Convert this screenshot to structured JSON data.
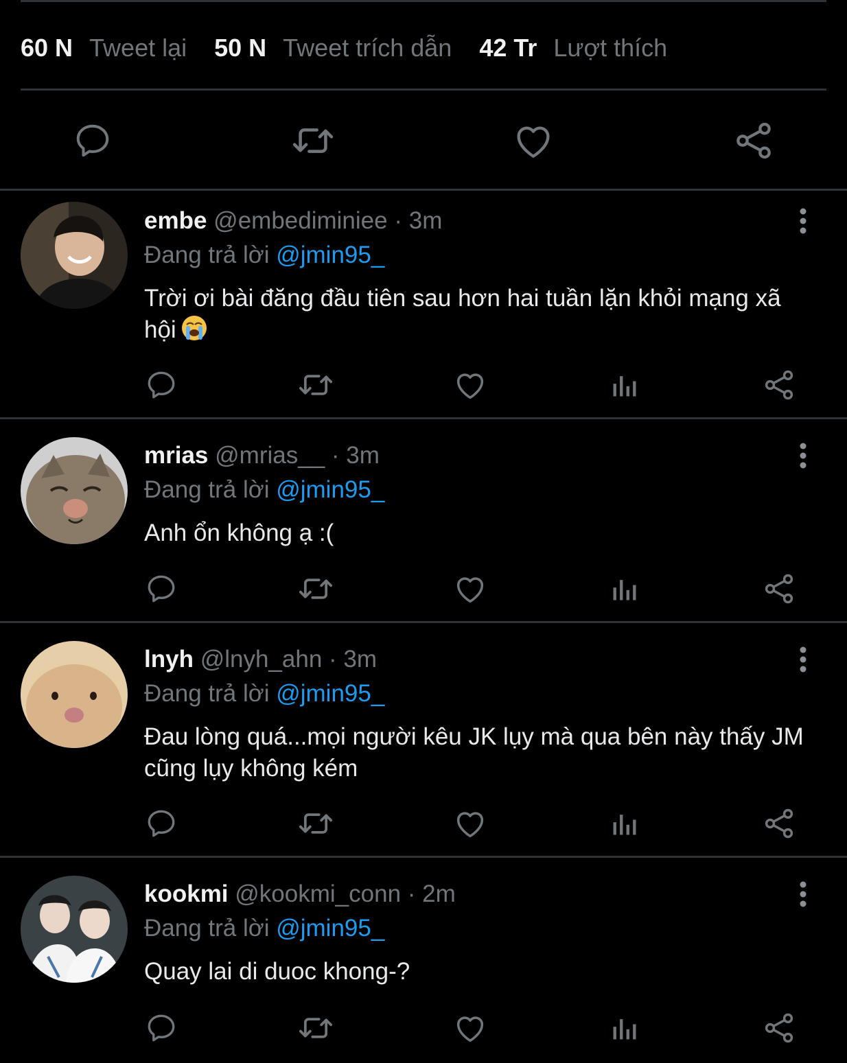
{
  "stats": [
    {
      "value": "60 N",
      "label": "Tweet lại"
    },
    {
      "value": "50 N",
      "label": "Tweet trích dẫn"
    },
    {
      "value": "42 Tr",
      "label": "Lượt thích"
    }
  ],
  "main_actions": [
    "comment-icon",
    "retweet-icon",
    "heart-icon",
    "share-icon"
  ],
  "replies": [
    {
      "display_name": "embe",
      "handle": "@embediminiee",
      "time": "3m",
      "replying_label": "Đang trả lời",
      "mention": "@jmin95_",
      "text": "Trời ơi bài đăng đầu tiên sau hơn hai tuần lặn khỏi mạng xã hội",
      "emoji": "loudly-crying-face"
    },
    {
      "display_name": "mrias",
      "handle": "@mrias__",
      "time": "3m",
      "replying_label": "Đang trả lời",
      "mention": "@jmin95_",
      "text": "Anh ổn không ạ :("
    },
    {
      "display_name": "lnyh",
      "handle": "@lnyh_ahn",
      "time": "3m",
      "replying_label": "Đang trả lời",
      "mention": "@jmin95_",
      "text": "Đau lòng quá...mọi người kêu JK lụy mà qua bên này thấy JM cũng lụy không kém"
    },
    {
      "display_name": "kookmi",
      "handle": "@kookmi_conn",
      "time": "2m",
      "replying_label": "Đang trả lời",
      "mention": "@jmin95_",
      "text": "Quay lai di duoc khong-?"
    }
  ],
  "reply_actions": [
    "reply-icon",
    "retweet-icon",
    "like-icon",
    "analytics-icon",
    "share-icon"
  ],
  "colors": {
    "background": "#000000",
    "text": "#e7e9ea",
    "muted": "#71767b",
    "accent": "#1d9bf0",
    "divider": "#2f3336"
  }
}
